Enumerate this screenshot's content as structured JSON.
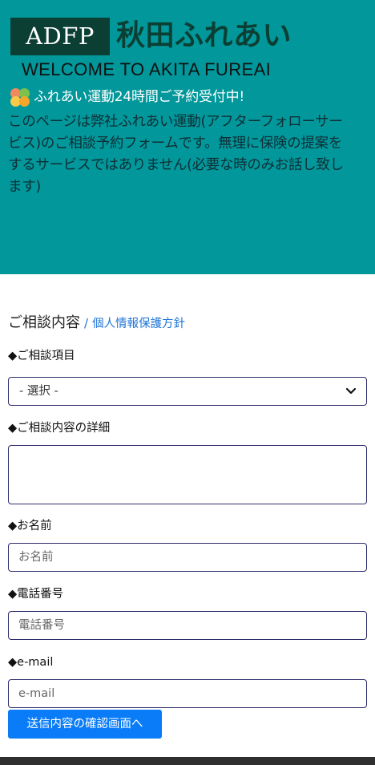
{
  "header": {
    "logo_text": "ADFP",
    "brand_jp": "秋田ふれあい",
    "welcome": "WELCOME TO AKITA FUREAI",
    "notice_title": "ふれあい運動24時間ご予約受付中!",
    "notice_body": "このページは弊社ふれあい運動(アフターフォローサービス)のご相談予約フォームです。無理に保険の提案をするサービスではありません(必要な時のみお話し致します)",
    "colors": {
      "hero_bg": "#01979b",
      "logo_bg": "#0c3f33",
      "submit_bg": "#0a7cf8"
    }
  },
  "form": {
    "section_title": "ご相談内容",
    "separator": "/",
    "privacy_link": "個人情報保護方針",
    "consult_item": {
      "label": "◆ご相談項目",
      "selected": "- 選択 -"
    },
    "details": {
      "label": "◆ご相談内容の詳細"
    },
    "name": {
      "label": "◆お名前",
      "placeholder": "お名前"
    },
    "phone": {
      "label": "◆電話番号",
      "placeholder": "電話番号"
    },
    "email": {
      "label": "◆e-mail",
      "placeholder": "e-mail"
    },
    "submit_label": "送信内容の確認画面へ"
  }
}
